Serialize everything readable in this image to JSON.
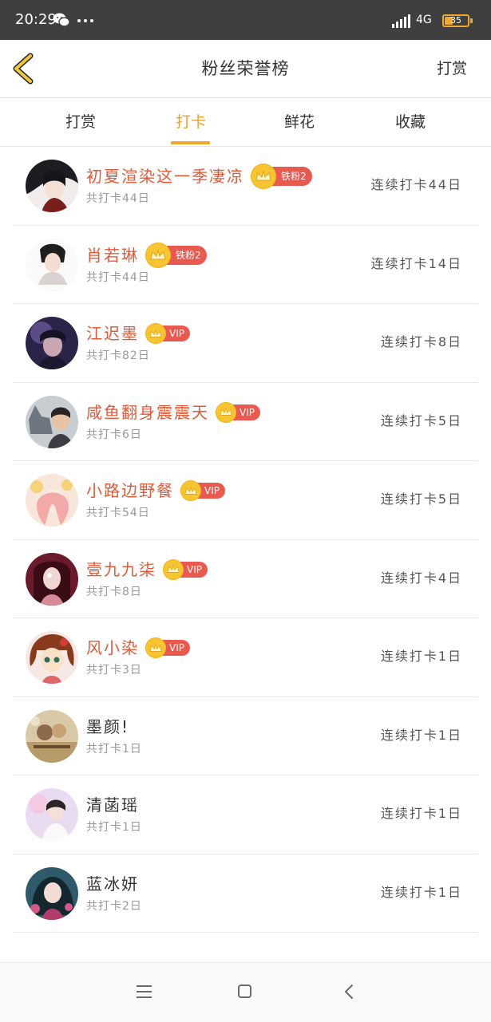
{
  "status_bar": {
    "time": "20:29",
    "network": "4G",
    "battery": "35",
    "battery_level": 0.35,
    "icons": [
      "wechat-icon",
      "more-dots-icon",
      "signal-icon"
    ]
  },
  "header": {
    "title": "粉丝荣誉榜",
    "action": "打赏",
    "back_icon": "chevron-left-icon"
  },
  "tabs": [
    {
      "label": "打赏",
      "active": false
    },
    {
      "label": "打卡",
      "active": true
    },
    {
      "label": "鲜花",
      "active": false
    },
    {
      "label": "收藏",
      "active": false
    }
  ],
  "colors": {
    "accent": "#f0a92d",
    "name_highlight": "#e05a3a",
    "badge_red": "#e85a50",
    "crown_gold": "#f6c531"
  },
  "fans": [
    {
      "name": "初夏渲染这一季凄凉",
      "badge": "铁粉2",
      "total": "共打卡44日",
      "streak": "连续打卡44日"
    },
    {
      "name": "肖若琳",
      "badge": "铁粉2",
      "total": "共打卡44日",
      "streak": "连续打卡14日"
    },
    {
      "name": "江迟墨",
      "badge": "VIP",
      "total": "共打卡82日",
      "streak": "连续打卡8日"
    },
    {
      "name": "咸鱼翻身震震天",
      "badge": "VIP",
      "total": "共打卡6日",
      "streak": "连续打卡5日"
    },
    {
      "name": "小路边野餐",
      "badge": "VIP",
      "total": "共打卡54日",
      "streak": "连续打卡5日"
    },
    {
      "name": "壹九九柒",
      "badge": "VIP",
      "total": "共打卡8日",
      "streak": "连续打卡4日"
    },
    {
      "name": "风小染",
      "badge": "VIP",
      "total": "共打卡3日",
      "streak": "连续打卡1日"
    },
    {
      "name": "墨颜!",
      "badge": "",
      "total": "共打卡1日",
      "streak": "连续打卡1日"
    },
    {
      "name": "清菡瑶",
      "badge": "",
      "total": "共打卡1日",
      "streak": "连续打卡1日"
    },
    {
      "name": "蓝冰妍",
      "badge": "",
      "total": "共打卡2日",
      "streak": "连续打卡1日"
    }
  ],
  "system_nav": {
    "icons": [
      "menu-icon",
      "home-icon",
      "back-icon"
    ]
  }
}
